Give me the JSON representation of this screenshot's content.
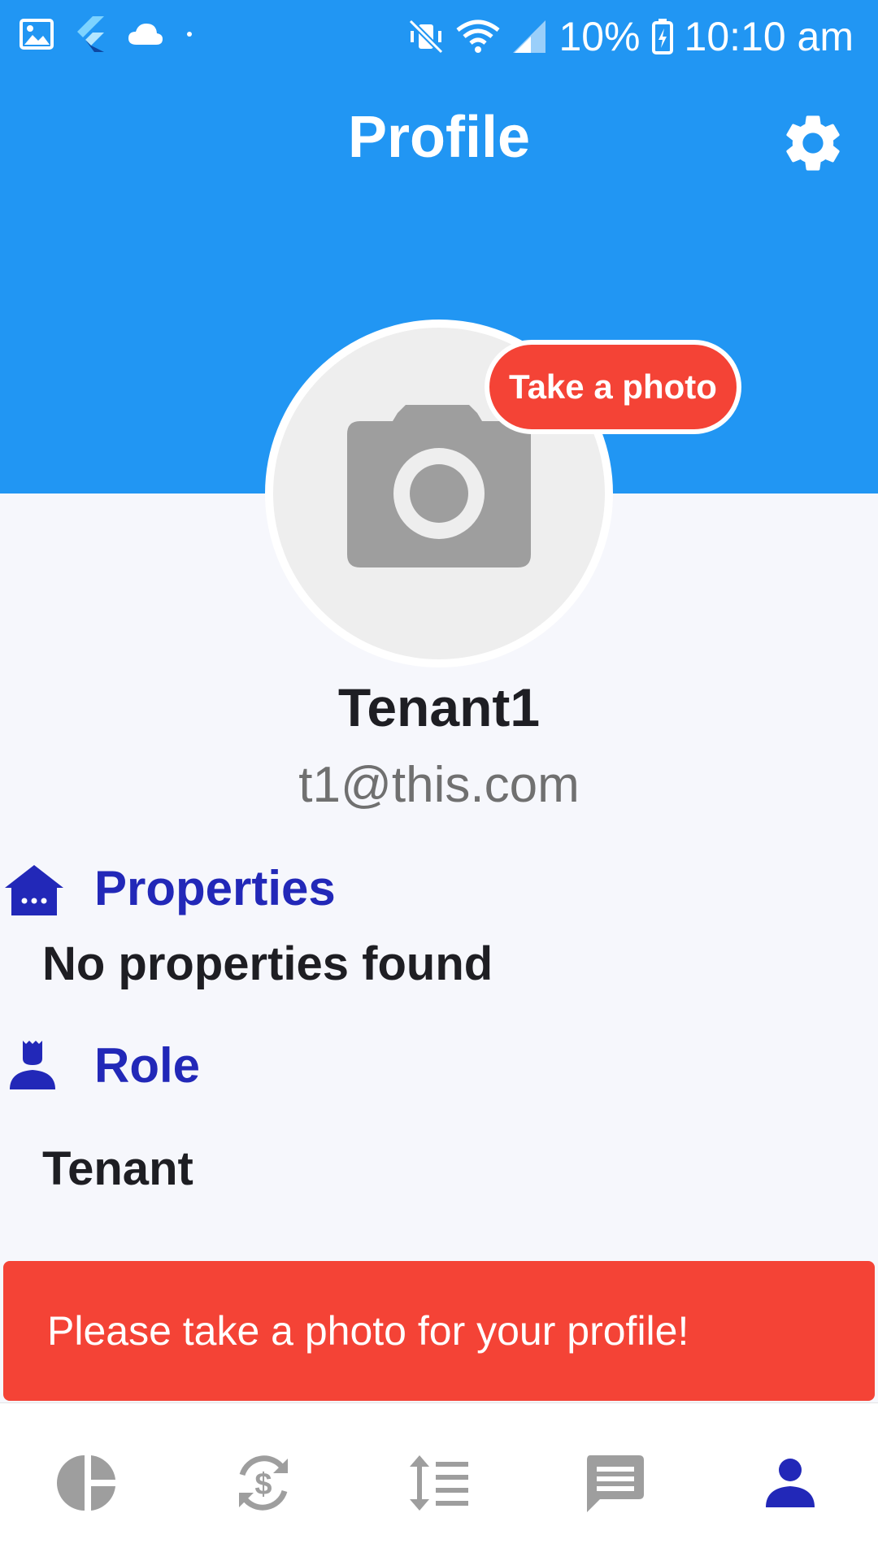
{
  "status_bar": {
    "battery": "10%",
    "time": "10:10 am"
  },
  "header": {
    "title": "Profile"
  },
  "avatar": {
    "take_photo_label": "Take a photo"
  },
  "user": {
    "name": "Tenant1",
    "email": "t1@this.com"
  },
  "properties": {
    "title": "Properties",
    "value": "No properties found"
  },
  "role": {
    "title": "Role",
    "value": "Tenant"
  },
  "snackbar": {
    "message": "Please take a photo for your profile!"
  },
  "bottom_nav": {
    "items": [
      "pie-chart-icon",
      "currency-exchange-icon",
      "sort-list-icon",
      "chat-icon",
      "person-icon"
    ],
    "active_index": 4
  },
  "colors": {
    "primary": "#2196f3",
    "accent": "#f44336",
    "section_title": "#2228b8",
    "nav_active": "#2228b8",
    "nav_inactive": "#9e9e9e",
    "background": "#f6f7fc"
  }
}
